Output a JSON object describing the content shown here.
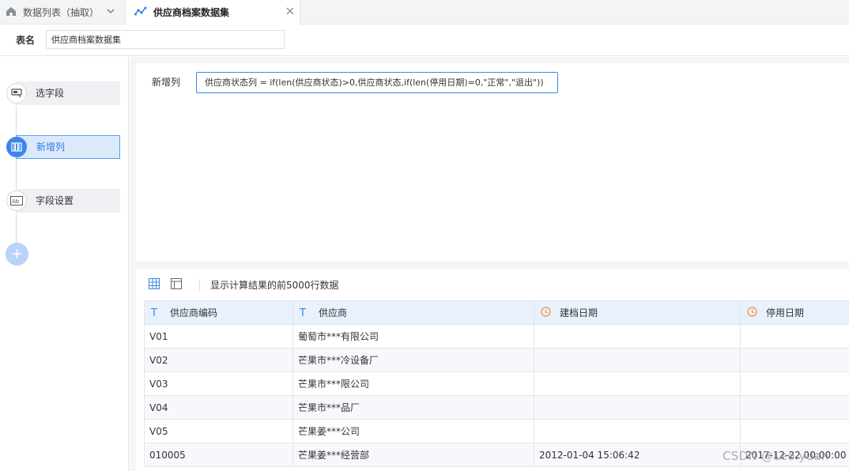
{
  "tabs": [
    {
      "label": "数据列表（抽取）",
      "icon": "home-icon"
    },
    {
      "label": "供应商档案数据集",
      "icon": "line-chart-icon"
    }
  ],
  "table_name": {
    "label": "表名",
    "value": "供应商档案数据集"
  },
  "steps": [
    {
      "label": "选字段",
      "icon": "select-fields-icon",
      "active": false
    },
    {
      "label": "新增列",
      "icon": "columns-icon",
      "active": true
    },
    {
      "label": "字段设置",
      "icon": "text-field-icon",
      "active": false
    }
  ],
  "add_step": {
    "symbol": "+"
  },
  "formula": {
    "label": "新增列",
    "expression": "供应商状态列 = if(len(供应商状态)>0,供应商状态,if(len(停用日期)=0,\"正常\",\"退出\"))"
  },
  "result": {
    "info": "显示计算结果的前5000行数据"
  },
  "grid": {
    "columns": [
      {
        "label": "供应商编码",
        "type": "text"
      },
      {
        "label": "供应商",
        "type": "text"
      },
      {
        "label": "建档日期",
        "type": "date"
      },
      {
        "label": "停用日期",
        "type": "date"
      }
    ],
    "rows": [
      [
        "V01",
        "葡萄市***有限公司",
        "",
        ""
      ],
      [
        "V02",
        "芒果市***冷设备厂",
        "",
        ""
      ],
      [
        "V03",
        "芒果市***限公司",
        "",
        ""
      ],
      [
        "V04",
        "芒果市***品厂",
        "",
        ""
      ],
      [
        "V05",
        "芒果姜***公司",
        "",
        ""
      ],
      [
        "010005",
        "芒果姜***经营部",
        "2012-01-04 15:06:42",
        "2017-12-22 00:00:00"
      ]
    ]
  },
  "watermark": "CSDN @Leo.yuan",
  "colors": {
    "accent": "#3b86ea",
    "header_bg": "#e9f1fc",
    "date_icon": "#f0923a"
  }
}
